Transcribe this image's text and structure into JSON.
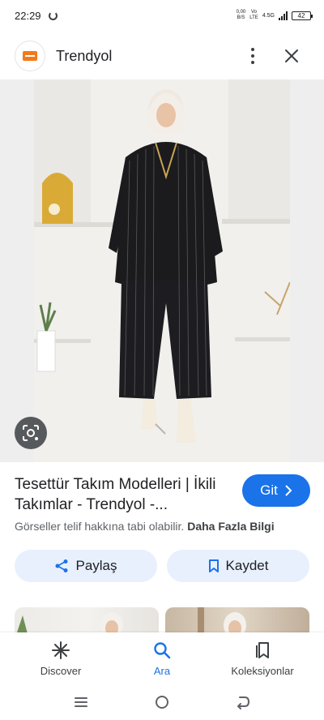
{
  "status_bar": {
    "time": "22:29",
    "net_speed_top": "0,00",
    "net_speed_bottom": "B/S",
    "volte_top": "Vo",
    "volte_bottom": "LTE",
    "network": "4.5G",
    "battery": "42"
  },
  "header": {
    "site_name": "Trendyol",
    "logo_icon": "trendyol-logo-icon",
    "brand_color": "#f27a1a"
  },
  "result": {
    "title": "Tesettür Takım Modelleri | İkili Takımlar - Trendyol -...",
    "go_label": "Git",
    "copyright_text": "Görseller telif hakkına tabi olabilir.",
    "more_info_label": "Daha Fazla Bilgi",
    "share_label": "Paylaş",
    "save_label": "Kaydet"
  },
  "bottom_nav": {
    "items": [
      {
        "label": "Discover",
        "icon": "asterisk-icon"
      },
      {
        "label": "Ara",
        "icon": "search-icon",
        "active": true
      },
      {
        "label": "Koleksiyonlar",
        "icon": "collections-icon"
      }
    ]
  },
  "colors": {
    "accent": "#1a73e8",
    "button_tonal": "#e8f0fe"
  }
}
